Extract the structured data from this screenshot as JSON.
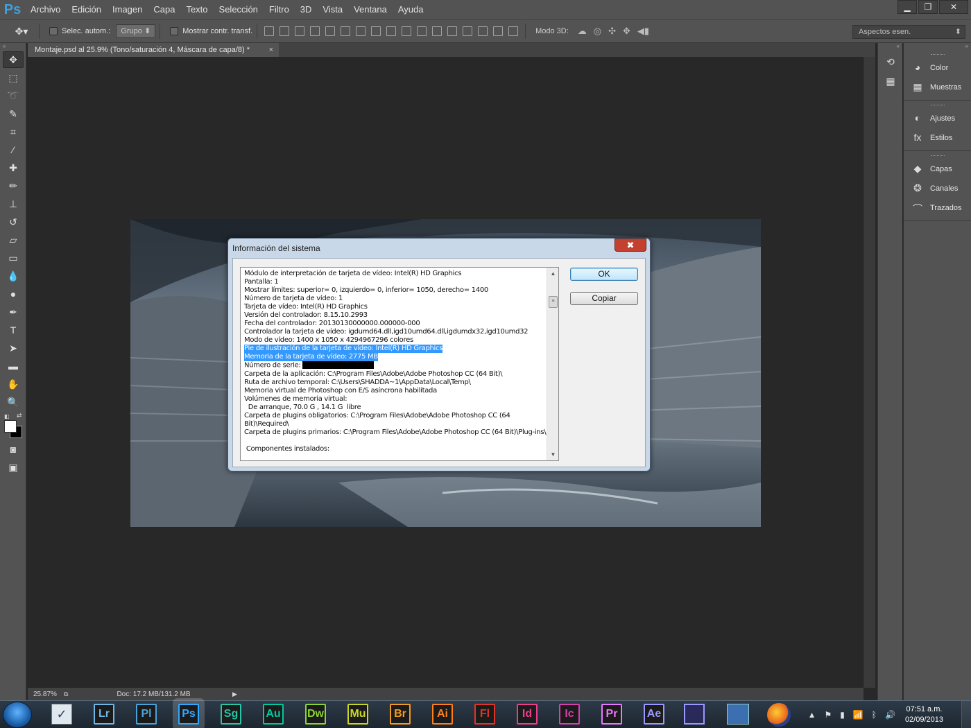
{
  "app": {
    "logo": "Ps"
  },
  "menu": [
    "Archivo",
    "Edición",
    "Imagen",
    "Capa",
    "Texto",
    "Selección",
    "Filtro",
    "3D",
    "Vista",
    "Ventana",
    "Ayuda"
  ],
  "window_controls": {
    "minimize": "▁",
    "restore": "❐",
    "close": "✕"
  },
  "options": {
    "auto_select_label": "Selec. autom.:",
    "group_value": "Grupo",
    "show_transform_label": "Mostrar contr. transf.",
    "mode3d_label": "Modo 3D:",
    "workspace": "Aspectos esen."
  },
  "document": {
    "tab_title": "Montaje.psd al 25.9% (Tono/saturación 4, Máscara de capa/8) *",
    "tab_close": "×"
  },
  "status": {
    "zoom": "25.87%",
    "doc": "Doc: 17.2 MB/131.2 MB"
  },
  "panels": {
    "group1": [
      {
        "label": "Color",
        "icon": "palette-icon"
      },
      {
        "label": "Muestras",
        "icon": "grid-icon"
      }
    ],
    "group2": [
      {
        "label": "Ajustes",
        "icon": "adjustments-icon"
      },
      {
        "label": "Estilos",
        "icon": "fx-icon"
      }
    ],
    "group3": [
      {
        "label": "Capas",
        "icon": "layers-icon"
      },
      {
        "label": "Canales",
        "icon": "channels-icon"
      },
      {
        "label": "Trazados",
        "icon": "paths-icon"
      }
    ]
  },
  "dialog": {
    "title": "Información del sistema",
    "close": "✖",
    "ok": "OK",
    "copy": "Copiar",
    "lines": [
      "Módulo de interpretación de tarjeta de vídeo: Intel(R) HD Graphics",
      "Pantalla: 1",
      "Mostrar límites: superior= 0, izquierdo= 0, inferior= 1050, derecho= 1400",
      "Número de tarjeta de vídeo: 1",
      "Tarjeta de vídeo: Intel(R) HD Graphics",
      "Versión del controlador: 8.15.10.2993",
      "Fecha del controlador: 20130130000000.000000-000",
      "Controlador la tarjeta de vídeo: igdumd64.dll,igd10umd64.dll,igdumdx32,igd10umd32",
      "Modo de vídeo: 1400 x 1050 x 4294967296 colores",
      "Pie de ilustración de la tarjeta de vídeo: Intel(R) HD Graphics",
      "Memoria de la tarjeta de vídeo: 2775 MB",
      "Número de serie: ",
      "Carpeta de la aplicación: C:\\Program Files\\Adobe\\Adobe Photoshop CC (64 Bit)\\",
      "Ruta de archivo temporal: C:\\Users\\SHADDA~1\\AppData\\Local\\Temp\\",
      "Memoria virtual de Photoshop con E/S asíncrona habilitada",
      "Volúmenes de memoria virtual:",
      "  De arranque, 70.0 G , 14.1 G  libre",
      "Carpeta de plugins obligatorios: C:\\Program Files\\Adobe\\Adobe Photoshop CC (64",
      "Bit)\\Required\\",
      "Carpeta de plugins primarios: C:\\Program Files\\Adobe\\Adobe Photoshop CC (64 Bit)\\Plug-ins\\",
      "",
      " Componentes instalados:"
    ],
    "highlighted_lines": [
      9,
      10
    ],
    "redacted_line": 11
  },
  "taskbar": {
    "apps": [
      {
        "label": "Lr",
        "color": "#6fb7e6"
      },
      {
        "label": "Pl",
        "color": "#4aa3d8"
      },
      {
        "label": "Ps",
        "color": "#31a8ff"
      },
      {
        "label": "Sg",
        "color": "#26c6a6"
      },
      {
        "label": "Au",
        "color": "#00c8a0"
      },
      {
        "label": "Dw",
        "color": "#8bd431"
      },
      {
        "label": "Mu",
        "color": "#c8d622"
      },
      {
        "label": "Br",
        "color": "#f29b22"
      },
      {
        "label": "Ai",
        "color": "#ff7f18"
      },
      {
        "label": "Fl",
        "color": "#e0362a"
      },
      {
        "label": "Id",
        "color": "#ee3d8c"
      },
      {
        "label": "Ic",
        "color": "#d53fae"
      },
      {
        "label": "Pr",
        "color": "#ea77ff"
      },
      {
        "label": "Ae",
        "color": "#9999ff"
      }
    ],
    "time": "07:51 a.m.",
    "date": "02/09/2013"
  }
}
